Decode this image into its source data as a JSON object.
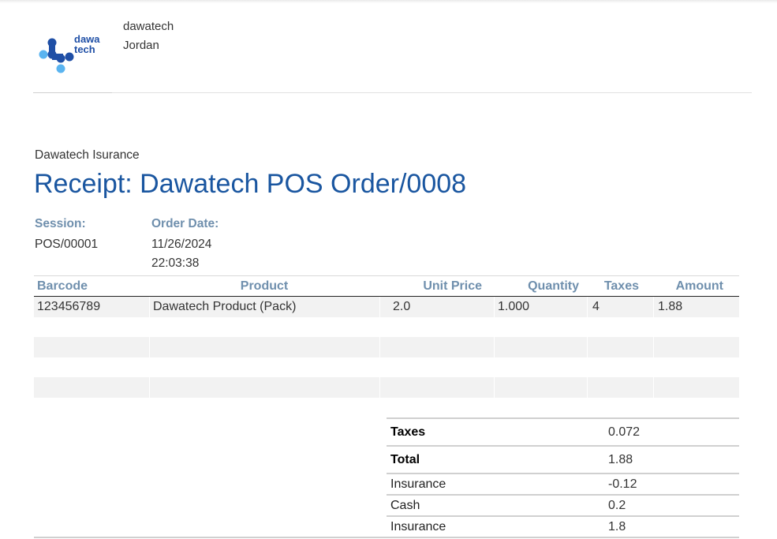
{
  "company": {
    "logo_text_top": "dawa",
    "logo_text_bottom": "tech",
    "name": "dawatech",
    "country": "Jordan"
  },
  "partner": "Dawatech Isurance",
  "title": "Receipt: Dawatech POS Order/0008",
  "info": {
    "session_label": "Session:",
    "session_value": "POS/00001",
    "date_label": "Order Date:",
    "date_value": "11/26/2024",
    "time_value": "22:03:38"
  },
  "lines": {
    "headers": [
      "Barcode",
      "Product",
      "Unit Price",
      "Quantity",
      "Taxes",
      "Amount"
    ],
    "rows": [
      [
        "123456789",
        "Dawatech Product (Pack)",
        "2.0",
        "1.000",
        "4",
        "1.88"
      ],
      [
        "",
        "",
        "",
        "",
        "",
        ""
      ],
      [
        "",
        "",
        "",
        "",
        "",
        ""
      ],
      [
        "",
        "",
        "",
        "",
        "",
        ""
      ],
      [
        "",
        "",
        "",
        "",
        "",
        ""
      ]
    ]
  },
  "totals": [
    {
      "label": "Taxes",
      "value": "0.072",
      "bold": true
    },
    {
      "label": "Total",
      "value": "1.88",
      "bold": true
    },
    {
      "label": "Insurance",
      "value": "-0.12",
      "bold": false
    },
    {
      "label": "Cash",
      "value": "0.2",
      "bold": false
    },
    {
      "label": "Insurance",
      "value": "1.8",
      "bold": false
    }
  ],
  "colors": {
    "title": "#1a56a0",
    "header_label": "#6f8fad",
    "logo_dark": "#1f4fa6",
    "logo_light": "#5ab4f0"
  }
}
